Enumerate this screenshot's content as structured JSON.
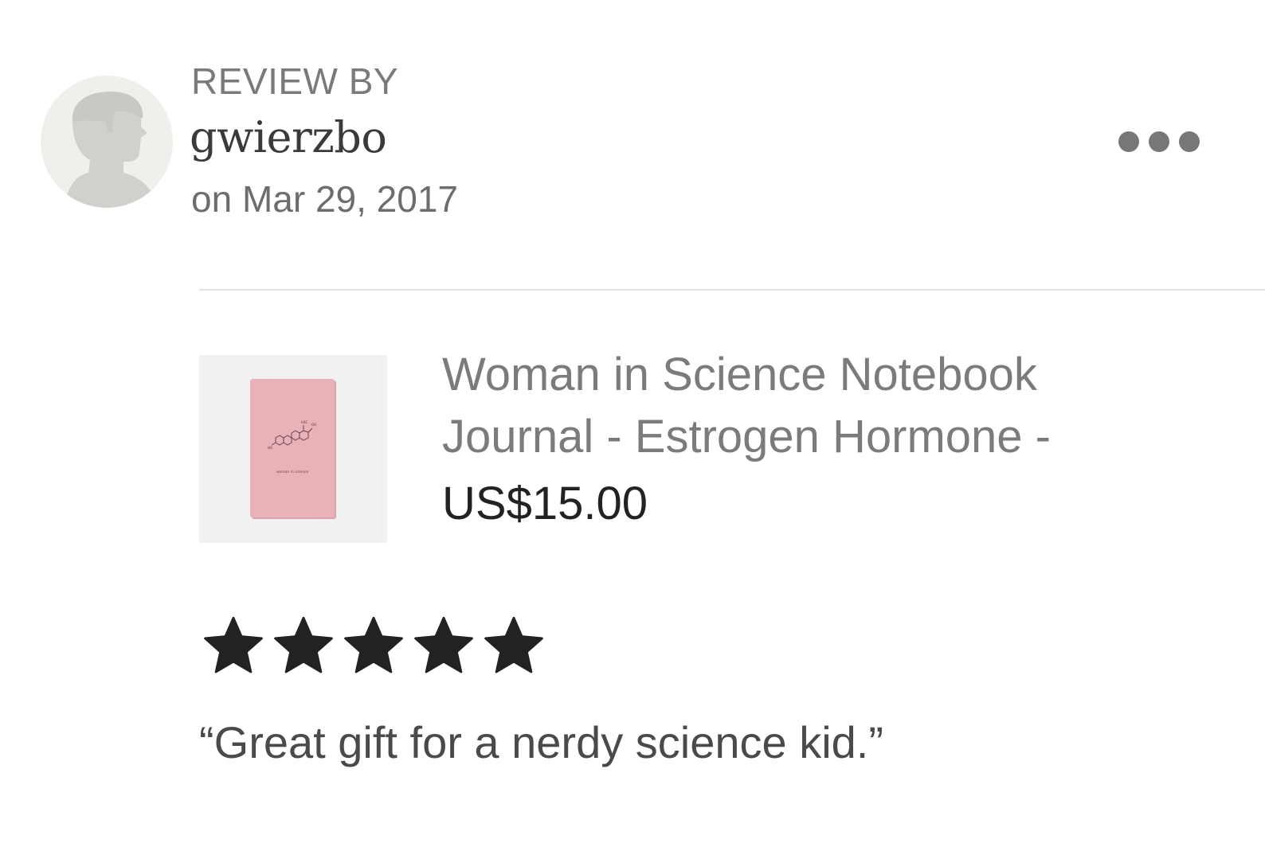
{
  "review": {
    "header_label": "REVIEW BY",
    "username": "gwierzbo",
    "date": "on Mar 29, 2017",
    "rating": 5,
    "rating_max": 5,
    "text": "“Great gift for a nerdy science kid.”"
  },
  "product": {
    "title_lines": [
      "Woman in Science Notebook",
      "Journal - Estrogen Hormone -"
    ],
    "price": "US$15.00",
    "cover_caption": "woman in science"
  },
  "icons": {
    "avatar": "default-user-silhouette-icon",
    "more": "more-options-dots-icon",
    "star": "filled-star-icon"
  },
  "colors": {
    "cover_pink": "#e9b2b9",
    "star": "#222222",
    "avatar_bg": "#efefeb",
    "avatar_silhouette": "#d0d0cd"
  }
}
